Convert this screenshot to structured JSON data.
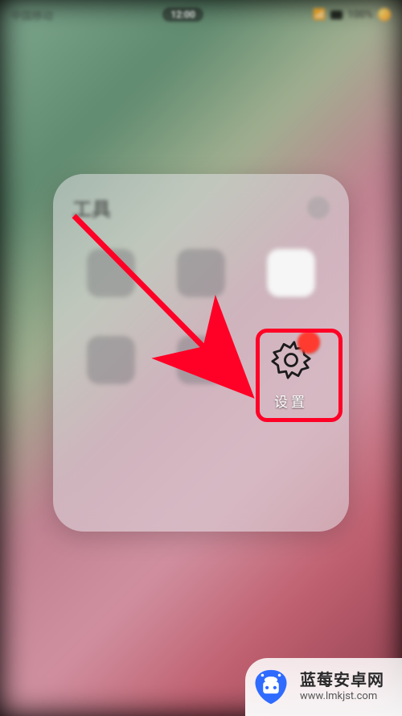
{
  "status": {
    "carrier": "中国移动",
    "time": "12:00",
    "battery": "100%"
  },
  "folder": {
    "title": "工具",
    "apps": [
      {
        "label": ""
      },
      {
        "label": ""
      },
      {
        "label": ""
      },
      {
        "label": ""
      },
      {
        "label": ""
      },
      {
        "label": "设置"
      }
    ]
  },
  "highlight": {
    "target_app": "settings-app",
    "arrow_color": "#ff0026"
  },
  "watermark": {
    "title": "蓝莓安卓网",
    "url": "www.lmkjst.com",
    "accent": "#2f6bff"
  }
}
